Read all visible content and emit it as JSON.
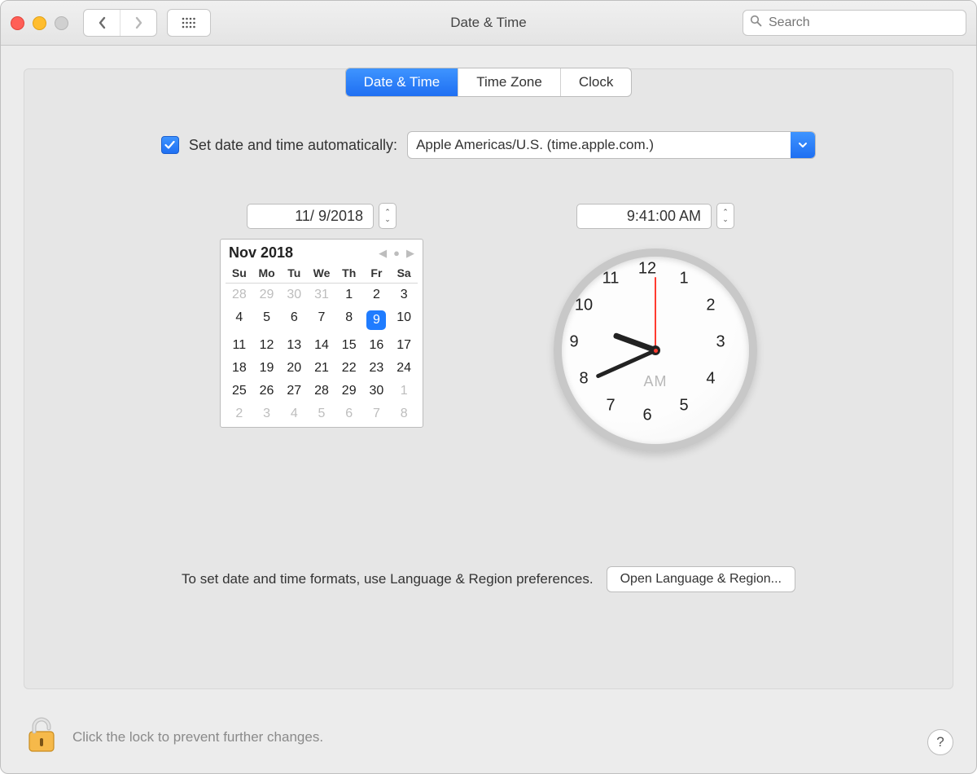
{
  "window": {
    "title": "Date & Time"
  },
  "search": {
    "placeholder": "Search"
  },
  "tabs": {
    "date_time": "Date & Time",
    "time_zone": "Time Zone",
    "clock": "Clock"
  },
  "auto": {
    "label": "Set date and time automatically:",
    "server": "Apple Americas/U.S. (time.apple.com.)",
    "checked": true
  },
  "date": {
    "value": "11/  9/2018"
  },
  "time": {
    "value": "9:41:00 AM"
  },
  "calendar": {
    "month_label": "Nov 2018",
    "dow": [
      "Su",
      "Mo",
      "Tu",
      "We",
      "Th",
      "Fr",
      "Sa"
    ],
    "leading_muted": [
      "28",
      "29",
      "30",
      "31"
    ],
    "days": [
      "1",
      "2",
      "3",
      "4",
      "5",
      "6",
      "7",
      "8",
      "9",
      "10",
      "11",
      "12",
      "13",
      "14",
      "15",
      "16",
      "17",
      "18",
      "19",
      "20",
      "21",
      "22",
      "23",
      "24",
      "25",
      "26",
      "27",
      "28",
      "29",
      "30"
    ],
    "trailing_muted": [
      "1",
      "2",
      "3",
      "4",
      "5",
      "6",
      "7",
      "8"
    ],
    "selected": "9"
  },
  "clock": {
    "numbers": [
      "12",
      "1",
      "2",
      "3",
      "4",
      "5",
      "6",
      "7",
      "8",
      "9",
      "10",
      "11"
    ],
    "ampm": "AM",
    "hour_angle": 290,
    "minute_angle": 246,
    "second_angle": 0
  },
  "footer": {
    "text": "To set date and time formats, use Language & Region preferences.",
    "button": "Open Language & Region..."
  },
  "lock": {
    "text": "Click the lock to prevent further changes."
  },
  "help": "?"
}
